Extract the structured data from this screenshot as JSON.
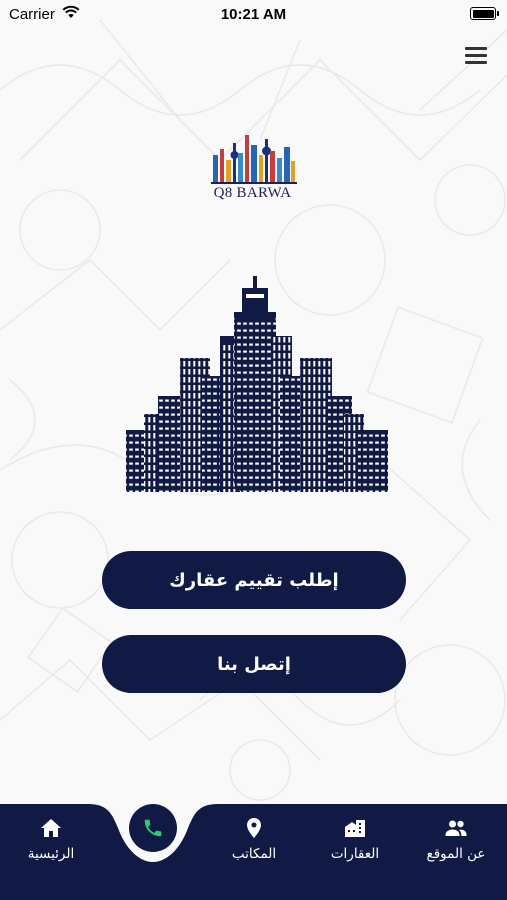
{
  "status_bar": {
    "carrier": "Carrier",
    "time": "10:21 AM"
  },
  "header": {
    "menu_icon": "hamburger-menu-icon"
  },
  "logo": {
    "text": "Q8 BARWA"
  },
  "actions": {
    "request_evaluation": "إطلب تقييم عقارك",
    "contact_us": "إتصل بنا"
  },
  "tabbar": {
    "home": {
      "label": "الرئيسية",
      "icon": "home-icon"
    },
    "call": {
      "icon": "phone-icon"
    },
    "offices": {
      "label": "المكاتب",
      "icon": "location-pin-icon"
    },
    "properties": {
      "label": "العقارات",
      "icon": "buildings-icon"
    },
    "about": {
      "label": "عن الموقع",
      "icon": "people-icon"
    }
  },
  "colors": {
    "primary": "#111a45",
    "call_icon": "#2ecc71",
    "background": "#f9f9fa"
  }
}
